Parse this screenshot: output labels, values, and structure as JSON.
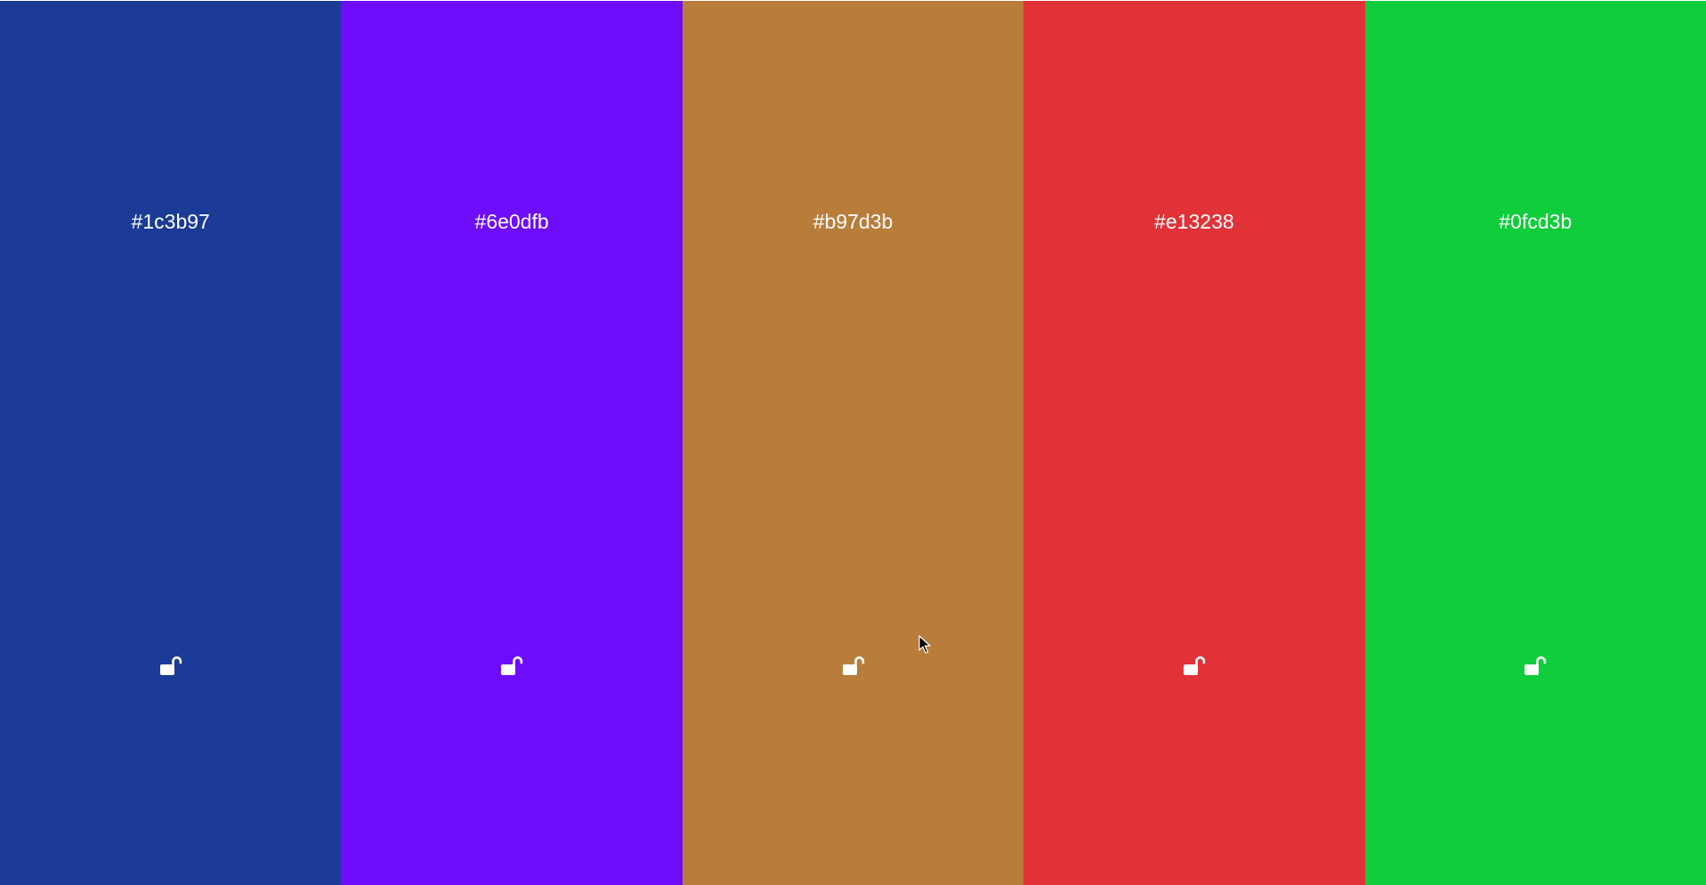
{
  "swatches": [
    {
      "hex": "#1c3b97",
      "color": "#1c3b97",
      "icon": "unlock-icon"
    },
    {
      "hex": "#6e0dfb",
      "color": "#6e0dfb",
      "icon": "unlock-icon"
    },
    {
      "hex": "#b97d3b",
      "color": "#b97d3b",
      "icon": "unlock-icon"
    },
    {
      "hex": "#e13238",
      "color": "#e13238",
      "icon": "unlock-icon"
    },
    {
      "hex": "#0fcd3b",
      "color": "#0fcd3b",
      "icon": "unlock-icon"
    }
  ]
}
